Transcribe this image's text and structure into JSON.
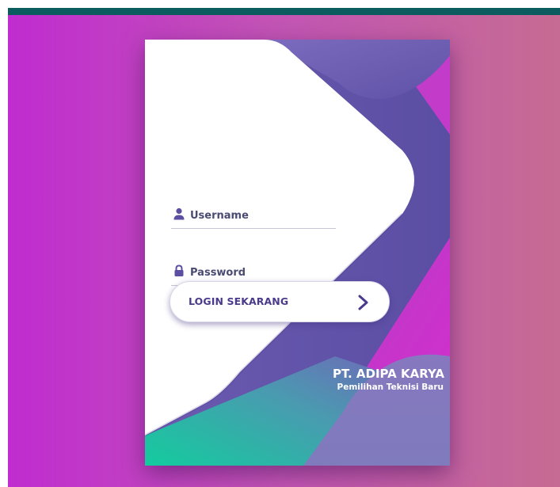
{
  "form": {
    "username_placeholder": "Username",
    "password_placeholder": "Password",
    "login_label": "LOGIN SEKARANG"
  },
  "brand": {
    "company_name": "PT. ADIPA KARYA",
    "tagline": "Pemilihan Teknisi Baru"
  },
  "icons": {
    "username": "user-icon",
    "password": "lock-icon",
    "login": "chevron-right-icon"
  },
  "colors": {
    "top_bar": "#0b5b5f",
    "background_left": "#c02cd0",
    "background_right": "#c66b93",
    "text_primary": "#4a4b72",
    "button_text": "#4b3a8c"
  }
}
